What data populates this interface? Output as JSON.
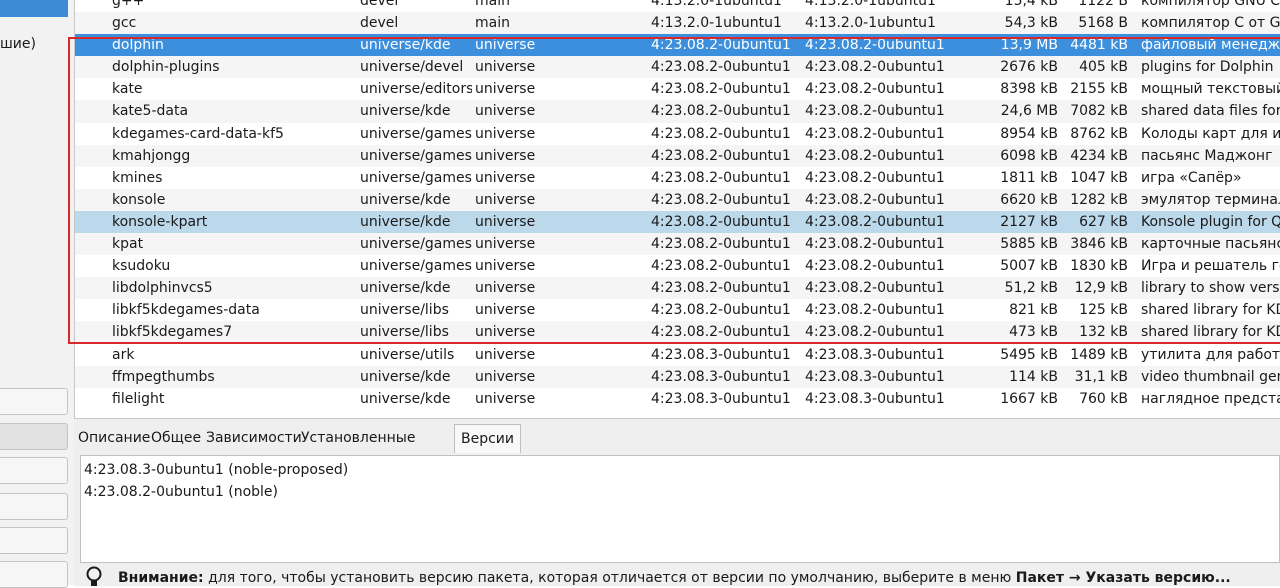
{
  "left_panel": {
    "partial_text": "шие)"
  },
  "table": {
    "rows": [
      {
        "name": "g++",
        "section": "devel",
        "component": "main",
        "installed": "4:13.2.0-1ubuntu1",
        "latest": "4:13.2.0-1ubuntu1",
        "size": "15,4 kB",
        "dlsize": "1122 B",
        "description": "компилятор GNU C++",
        "icon": "ubuntu-icon",
        "state": "normal"
      },
      {
        "name": "gcc",
        "section": "devel",
        "component": "main",
        "installed": "4:13.2.0-1ubuntu1",
        "latest": "4:13.2.0-1ubuntu1",
        "size": "54,3 kB",
        "dlsize": "5168 B",
        "description": "компилятор С от GNU",
        "icon": "ubuntu-icon",
        "state": "normal"
      },
      {
        "name": "dolphin",
        "section": "universe/kde",
        "component": "universe",
        "installed": "4:23.08.2-0ubuntu1",
        "latest": "4:23.08.2-0ubuntu1",
        "size": "13,9 MB",
        "dlsize": "4481 kB",
        "description": "файловый менеджер",
        "icon": "",
        "state": "selected"
      },
      {
        "name": "dolphin-plugins",
        "section": "universe/devel",
        "component": "universe",
        "installed": "4:23.08.2-0ubuntu1",
        "latest": "4:23.08.2-0ubuntu1",
        "size": "2676 kB",
        "dlsize": "405 kB",
        "description": "plugins for Dolphin",
        "icon": "",
        "state": "normal"
      },
      {
        "name": "kate",
        "section": "universe/editors",
        "component": "universe",
        "installed": "4:23.08.2-0ubuntu1",
        "latest": "4:23.08.2-0ubuntu1",
        "size": "8398 kB",
        "dlsize": "2155 kB",
        "description": "мощный текстовый р",
        "icon": "",
        "state": "normal"
      },
      {
        "name": "kate5-data",
        "section": "universe/kde",
        "component": "universe",
        "installed": "4:23.08.2-0ubuntu1",
        "latest": "4:23.08.2-0ubuntu1",
        "size": "24,6 MB",
        "dlsize": "7082 kB",
        "description": "shared data files for K",
        "icon": "",
        "state": "normal"
      },
      {
        "name": "kdegames-card-data-kf5",
        "section": "universe/games",
        "component": "universe",
        "installed": "4:23.08.2-0ubuntu1",
        "latest": "4:23.08.2-0ubuntu1",
        "size": "8954 kB",
        "dlsize": "8762 kB",
        "description": "Колоды карт для игр",
        "icon": "",
        "state": "normal"
      },
      {
        "name": "kmahjongg",
        "section": "universe/games",
        "component": "universe",
        "installed": "4:23.08.2-0ubuntu1",
        "latest": "4:23.08.2-0ubuntu1",
        "size": "6098 kB",
        "dlsize": "4234 kB",
        "description": "пасьянс Маджонг",
        "icon": "",
        "state": "normal"
      },
      {
        "name": "kmines",
        "section": "universe/games",
        "component": "universe",
        "installed": "4:23.08.2-0ubuntu1",
        "latest": "4:23.08.2-0ubuntu1",
        "size": "1811 kB",
        "dlsize": "1047 kB",
        "description": "игра «Сапёр»",
        "icon": "",
        "state": "normal"
      },
      {
        "name": "konsole",
        "section": "universe/kde",
        "component": "universe",
        "installed": "4:23.08.2-0ubuntu1",
        "latest": "4:23.08.2-0ubuntu1",
        "size": "6620 kB",
        "dlsize": "1282 kB",
        "description": "эмулятор терминала",
        "icon": "",
        "state": "normal"
      },
      {
        "name": "konsole-kpart",
        "section": "universe/kde",
        "component": "universe",
        "installed": "4:23.08.2-0ubuntu1",
        "latest": "4:23.08.2-0ubuntu1",
        "size": "2127 kB",
        "dlsize": "627 kB",
        "description": "Konsole plugin for Qt",
        "icon": "",
        "state": "hover"
      },
      {
        "name": "kpat",
        "section": "universe/games",
        "component": "universe",
        "installed": "4:23.08.2-0ubuntu1",
        "latest": "4:23.08.2-0ubuntu1",
        "size": "5885 kB",
        "dlsize": "3846 kB",
        "description": "карточные пасьянсы",
        "icon": "",
        "state": "normal"
      },
      {
        "name": "ksudoku",
        "section": "universe/games",
        "component": "universe",
        "installed": "4:23.08.2-0ubuntu1",
        "latest": "4:23.08.2-0ubuntu1",
        "size": "5007 kB",
        "dlsize": "1830 kB",
        "description": "Игра и решатель голо",
        "icon": "",
        "state": "normal"
      },
      {
        "name": "libdolphinvcs5",
        "section": "universe/kde",
        "component": "universe",
        "installed": "4:23.08.2-0ubuntu1",
        "latest": "4:23.08.2-0ubuntu1",
        "size": "51,2 kB",
        "dlsize": "12,9 kB",
        "description": "library to show version",
        "icon": "",
        "state": "normal"
      },
      {
        "name": "libkf5kdegames-data",
        "section": "universe/libs",
        "component": "universe",
        "installed": "4:23.08.2-0ubuntu1",
        "latest": "4:23.08.2-0ubuntu1",
        "size": "821 kB",
        "dlsize": "125 kB",
        "description": "shared library for KDE",
        "icon": "",
        "state": "normal"
      },
      {
        "name": "libkf5kdegames7",
        "section": "universe/libs",
        "component": "universe",
        "installed": "4:23.08.2-0ubuntu1",
        "latest": "4:23.08.2-0ubuntu1",
        "size": "473 kB",
        "dlsize": "132 kB",
        "description": "shared library for KDE",
        "icon": "",
        "state": "normal"
      },
      {
        "name": "ark",
        "section": "universe/utils",
        "component": "universe",
        "installed": "4:23.08.3-0ubuntu1",
        "latest": "4:23.08.3-0ubuntu1",
        "size": "5495 kB",
        "dlsize": "1489 kB",
        "description": "утилита для работы с",
        "icon": "",
        "state": "normal"
      },
      {
        "name": "ffmpegthumbs",
        "section": "universe/kde",
        "component": "universe",
        "installed": "4:23.08.3-0ubuntu1",
        "latest": "4:23.08.3-0ubuntu1",
        "size": "114 kB",
        "dlsize": "31,1 kB",
        "description": "video thumbnail gener",
        "icon": "",
        "state": "normal"
      },
      {
        "name": "filelight",
        "section": "universe/kde",
        "component": "universe",
        "installed": "4:23.08.3-0ubuntu1",
        "latest": "4:23.08.3-0ubuntu1",
        "size": "1667 kB",
        "dlsize": "760 kB",
        "description": "наглядное представл",
        "icon": "",
        "state": "normal"
      }
    ]
  },
  "tabs": [
    {
      "label": "Описание",
      "active": false
    },
    {
      "label": "Общее",
      "active": false
    },
    {
      "label": "Зависимости",
      "active": false
    },
    {
      "label": "Установленные файлы",
      "active": false
    },
    {
      "label": "Версии",
      "active": true
    }
  ],
  "versions": [
    "4:23.08.3-0ubuntu1 (noble-proposed)",
    "4:23.08.2-0ubuntu1 (noble)"
  ],
  "notice": {
    "label": "Внимание:",
    "text": " для того, чтобы установить версию пакета, которая отличается от версии по умолчанию, выберите в меню ",
    "menu_path": "Пакет → Указать версию..."
  },
  "colors": {
    "selection": "#3c8fdd",
    "hover": "#bcd9ec",
    "highlight_border": "#d9272e",
    "status_installed": "#7ea27e"
  }
}
